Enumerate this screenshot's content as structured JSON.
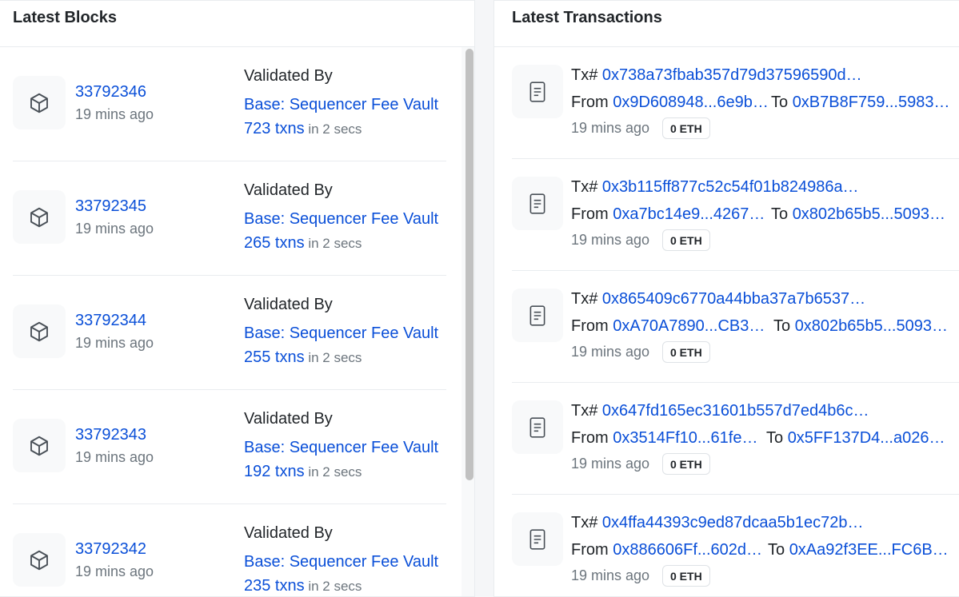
{
  "blocks_panel": {
    "title": "Latest Blocks",
    "validated_label": "Validated By",
    "blocks": [
      {
        "number": "33792346",
        "age": "19 mins ago",
        "validator": "Base: Sequencer Fee Vault",
        "txns": "723 txns",
        "duration": " in 2 secs"
      },
      {
        "number": "33792345",
        "age": "19 mins ago",
        "validator": "Base: Sequencer Fee Vault",
        "txns": "265 txns",
        "duration": " in 2 secs"
      },
      {
        "number": "33792344",
        "age": "19 mins ago",
        "validator": "Base: Sequencer Fee Vault",
        "txns": "255 txns",
        "duration": " in 2 secs"
      },
      {
        "number": "33792343",
        "age": "19 mins ago",
        "validator": "Base: Sequencer Fee Vault",
        "txns": "192 txns",
        "duration": " in 2 secs"
      },
      {
        "number": "33792342",
        "age": "19 mins ago",
        "validator": "Base: Sequencer Fee Vault",
        "txns": "235 txns",
        "duration": " in 2 secs"
      }
    ]
  },
  "tx_panel": {
    "title": "Latest Transactions",
    "tx_label": "Tx#",
    "from_label": "From",
    "to_label": "To",
    "transactions": [
      {
        "hash": "0x738a73fbab357d79d37596590d…",
        "from": "0x9D608948...6e9b…",
        "to": "0xB7B8F759...5983…",
        "age": "19 mins ago",
        "value": "0 ETH"
      },
      {
        "hash": "0x3b115ff877c52c54f01b824986a…",
        "from": "0xa7bc14e9...4267…",
        "to": "0x802b65b5...5093…",
        "age": "19 mins ago",
        "value": "0 ETH"
      },
      {
        "hash": "0x865409c6770a44bba37a7b6537…",
        "from": "0xA70A7890...CB3…",
        "to": "0x802b65b5...5093…",
        "age": "19 mins ago",
        "value": "0 ETH"
      },
      {
        "hash": "0x647fd165ec31601b557d7ed4b6c…",
        "from": "0x3514Ff10...61fe…",
        "to": "0x5FF137D4...a026…",
        "age": "19 mins ago",
        "value": "0 ETH"
      },
      {
        "hash": "0x4ffa44393c9ed87dcaa5b1ec72b…",
        "from": "0x886606Ff...602d…",
        "to": "0xAa92f3EE...FC6B…",
        "age": "19 mins ago",
        "value": "0 ETH"
      }
    ]
  },
  "icons": {
    "block": "cube-icon",
    "transaction": "document-icon"
  },
  "colors": {
    "link": "#0a4fd8",
    "muted": "#6c757d",
    "icon_bg": "#f8f9fa"
  }
}
